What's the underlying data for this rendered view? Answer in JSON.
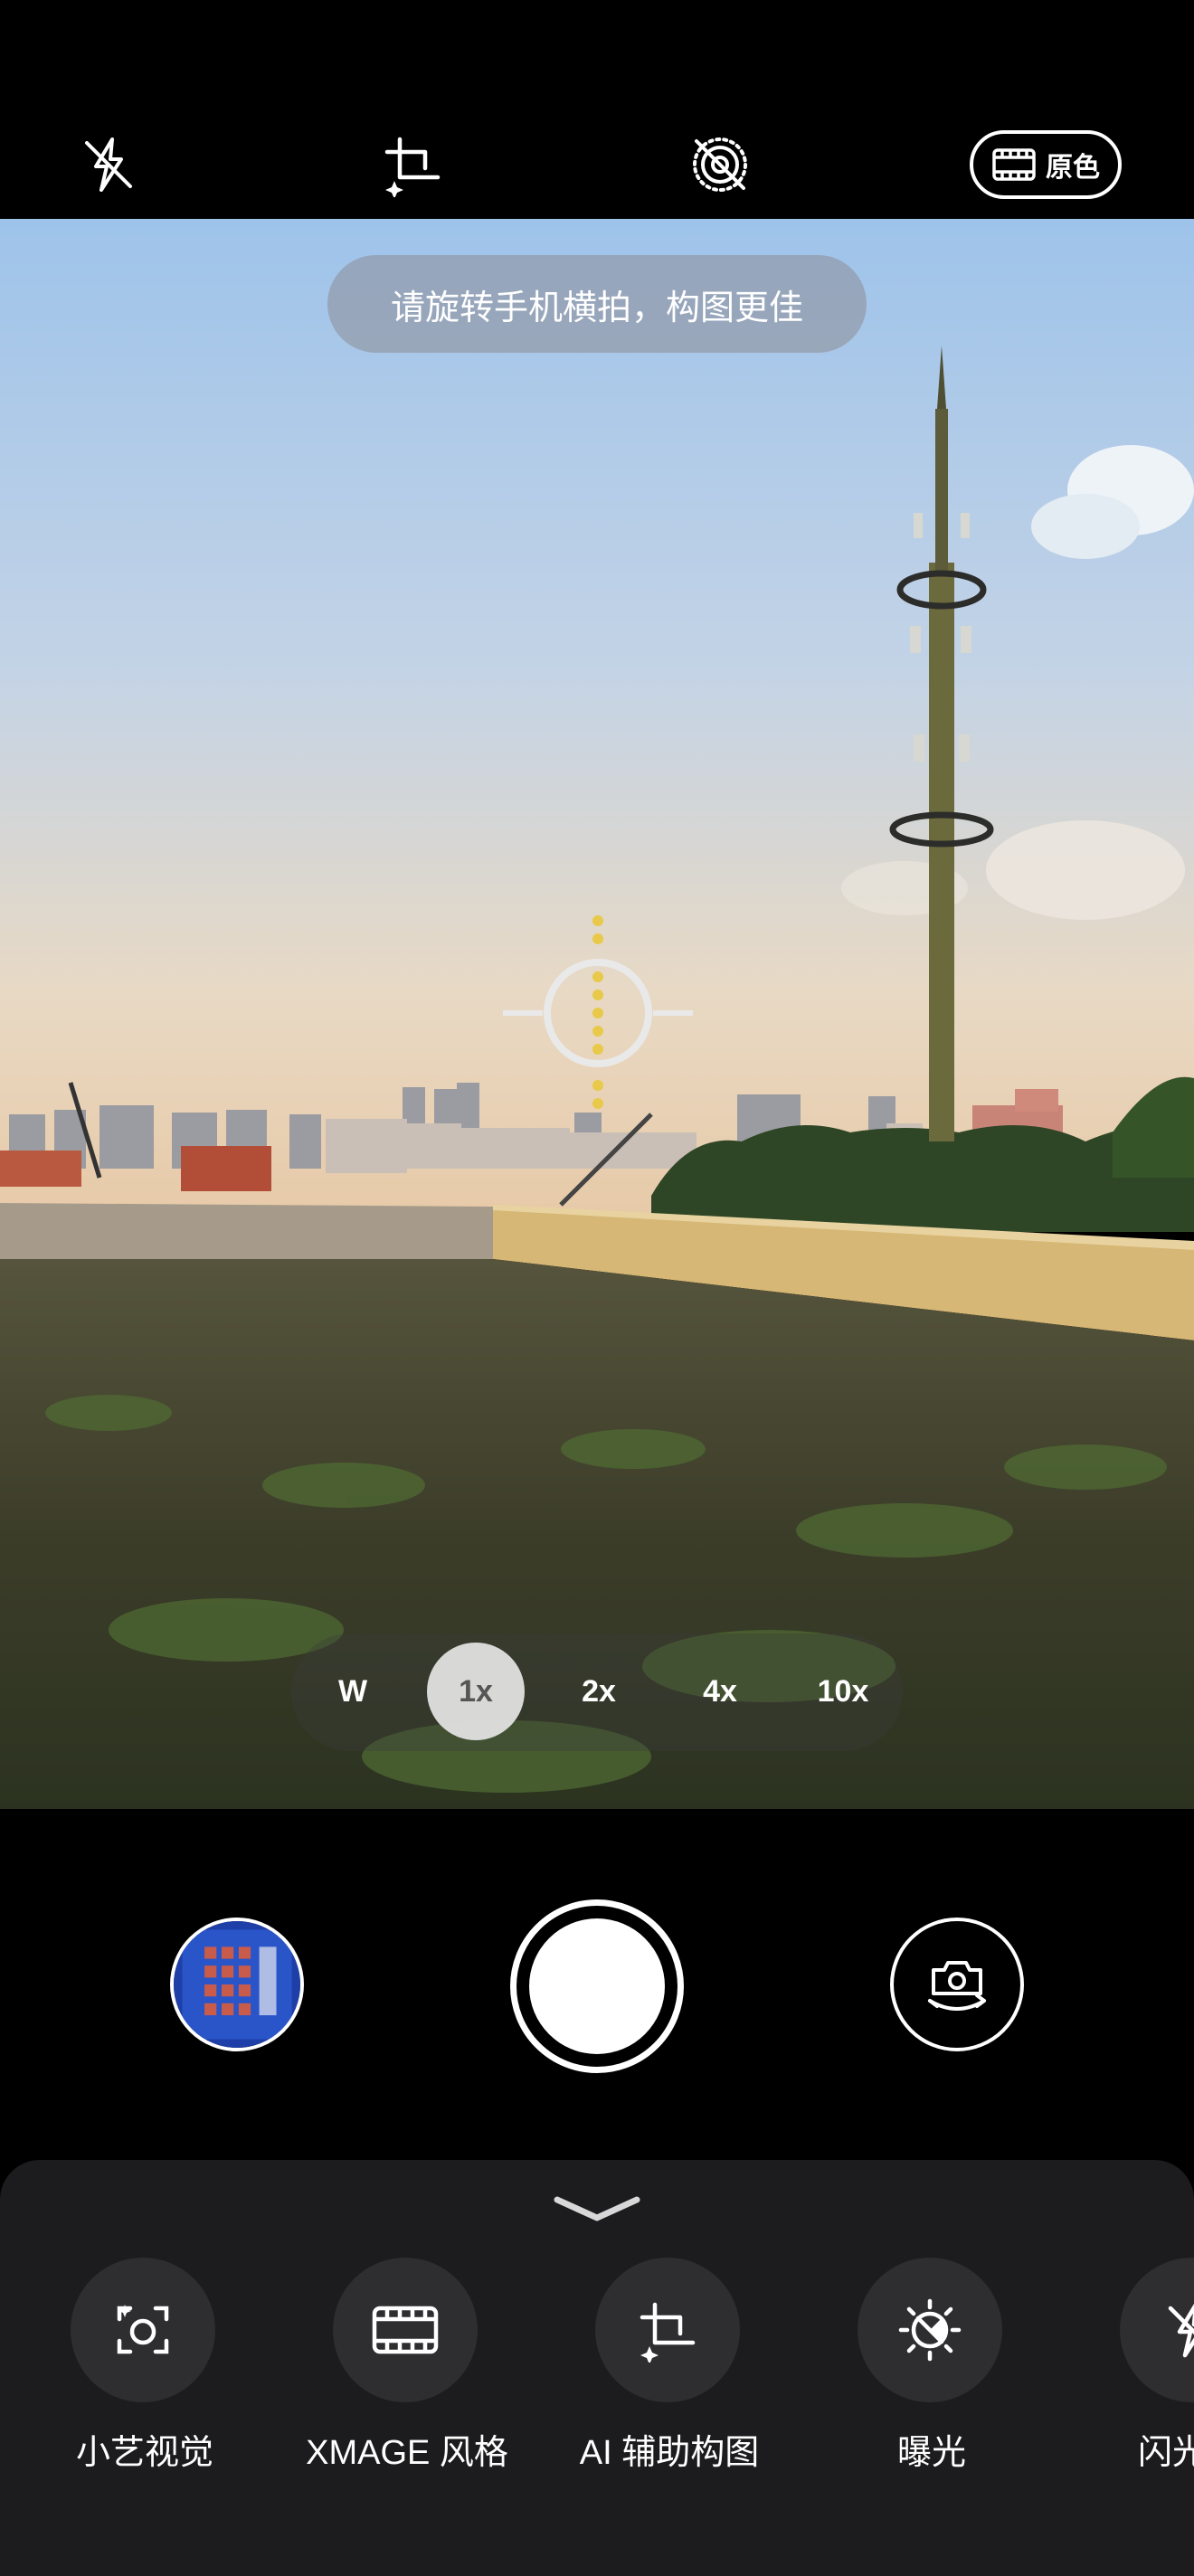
{
  "top_bar": {
    "flash_icon": "flash-off-icon",
    "composition_icon": "ai-crop-icon",
    "live_icon": "live-photo-off-icon",
    "style_icon": "film-icon",
    "style_label": "原色"
  },
  "viewfinder": {
    "hint": "请旋转手机横拍，构图更佳"
  },
  "zoom": {
    "options": [
      "W",
      "1x",
      "2x",
      "4x",
      "10x"
    ],
    "selected": "1x"
  },
  "controls": {
    "gallery_icon": "gallery-thumbnail",
    "shutter_icon": "shutter-button",
    "switch_icon": "camera-switch-icon"
  },
  "sheet": {
    "collapse_icon": "chevron-down-icon",
    "tools": [
      {
        "label": "小艺视觉",
        "icon": "scan-vision-icon"
      },
      {
        "label": "XMAGE 风格",
        "icon": "film-icon"
      },
      {
        "label": "AI 辅助构图",
        "icon": "ai-crop-icon"
      },
      {
        "label": "曝光",
        "icon": "exposure-icon"
      },
      {
        "label": "闪光",
        "icon": "flash-off-icon"
      }
    ]
  },
  "colors": {
    "focus_dots": "#e8c94a",
    "sheet_bg": "#1c1c1e",
    "tool_bg": "#2e2e30"
  }
}
